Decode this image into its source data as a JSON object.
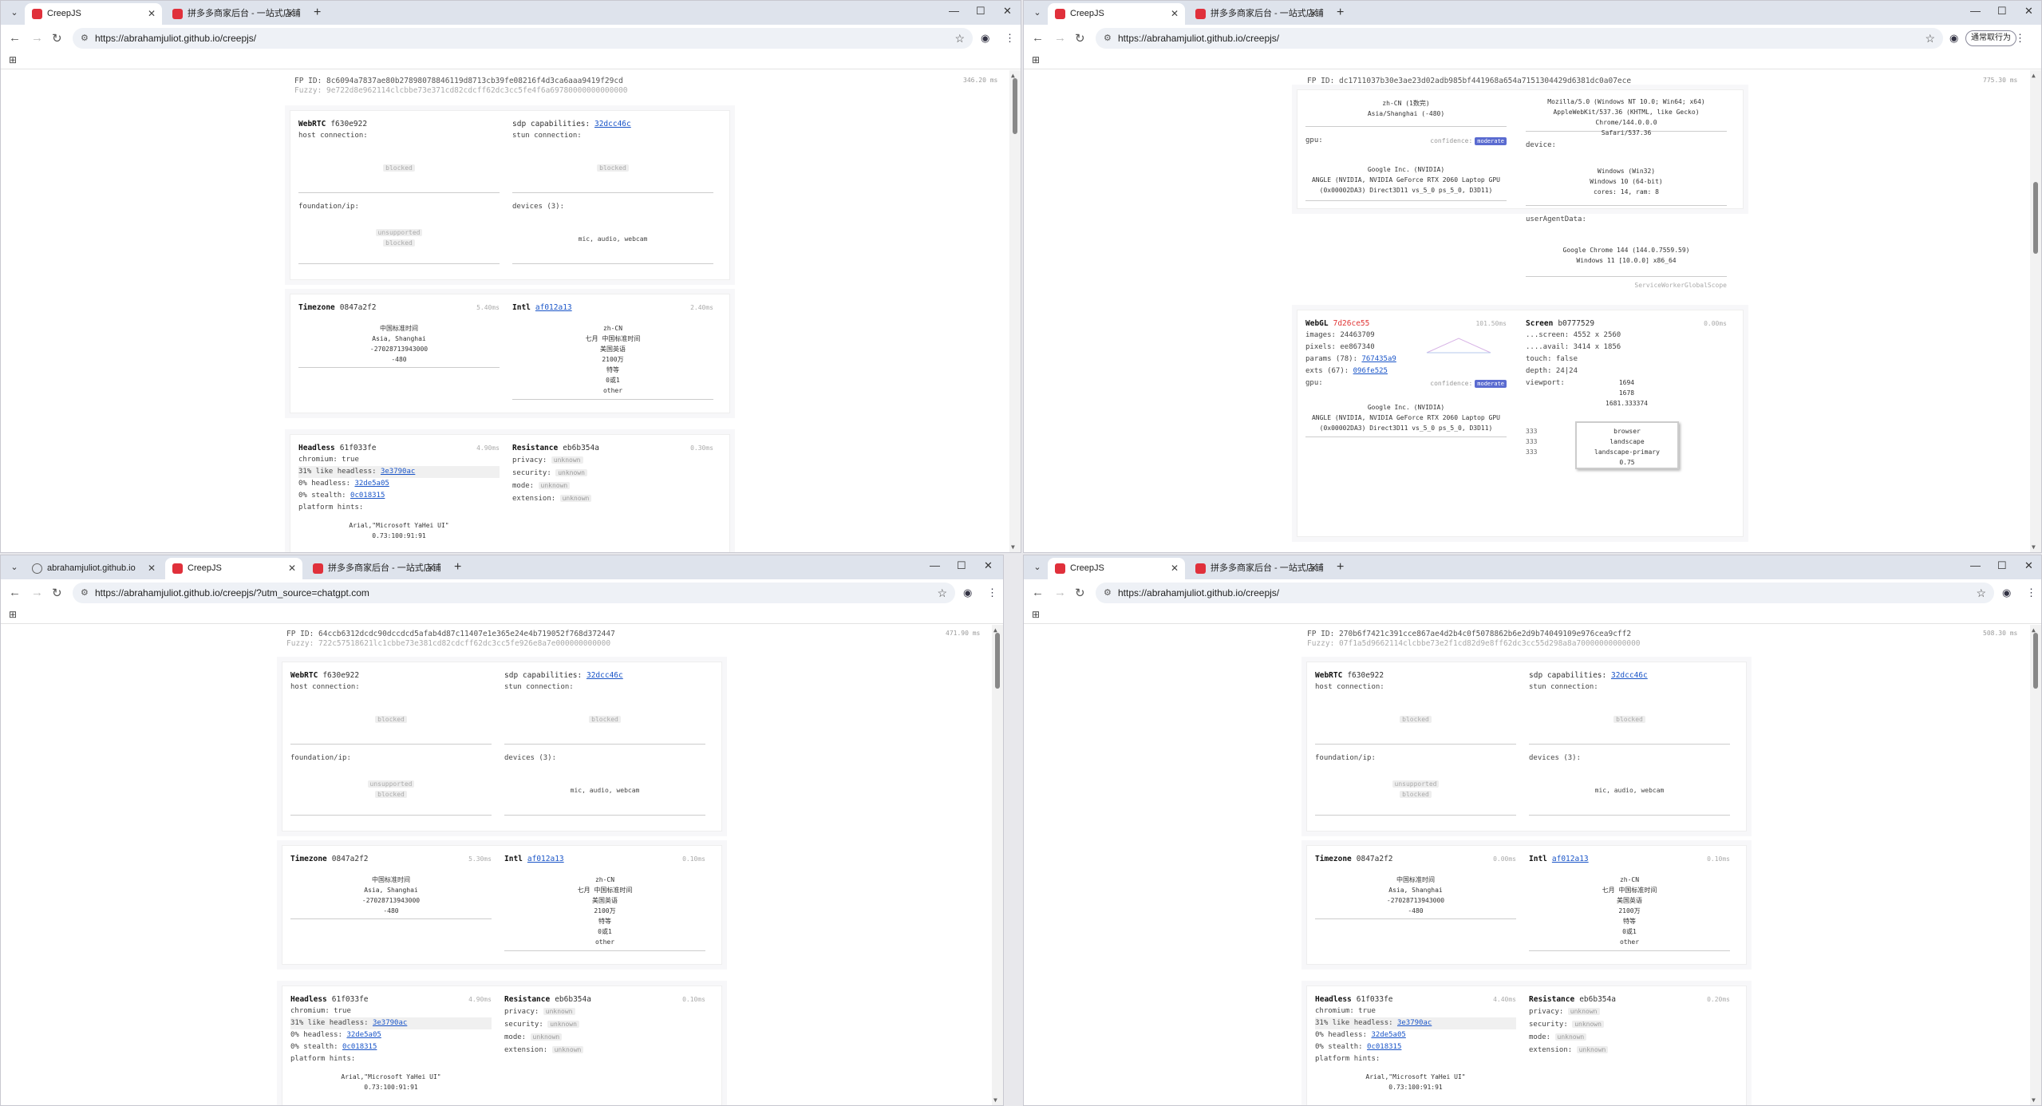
{
  "common": {
    "page_title": "CreepJS",
    "tab2_title": "拼多多商家后台 - 一站式店铺管",
    "url": "https://abrahamjuliot.github.io/creepjs/",
    "win_min": "—",
    "win_max": "☐",
    "win_close": "✕",
    "back": "←",
    "fwd": "→",
    "reload": "↻",
    "newtab": "+",
    "tab_close": "✕",
    "tabdrop": "⌄",
    "apps_glyph": "⊞",
    "star": "☆",
    "menu": "⋮",
    "profile": "◉",
    "tune": "⚙"
  },
  "win1": {
    "fp_id": "FP ID: 8c6094a7837ae80b27898078846119d8713cb39fe08216f4d3ca6aaa9419f29cd",
    "fuzzy": "Fuzzy: 9e722d8e962114clcbbe73e371cd82cdcff62dc3cc5fe4f6a69780000000000000",
    "perf": "346.20 ms",
    "webrtc": {
      "label": "WebRTC",
      "hash": "f630e922",
      "host": "host connection:",
      "host_val": "blocked",
      "sdp": "sdp capabilities:",
      "sdp_hash": "32dcc46c",
      "stun": "stun connection:",
      "stun_val": "blocked",
      "found": "foundation/ip:",
      "found_v1": "unsupported",
      "found_v2": "blocked",
      "devices": "devices (3):",
      "devices_val": "mic, audio, webcam"
    },
    "timezone": {
      "label": "Timezone",
      "hash": "0847a2f2",
      "ms": "5.40ms",
      "l1": "中国标准时间",
      "l2": "Asia, Shanghai",
      "l3": "-27028713943000",
      "l4": "-480"
    },
    "intl": {
      "label": "Intl",
      "hash": "af012a13",
      "ms": "2.40ms",
      "l1": "zh-CN",
      "l2": "七月 中国标准时间",
      "l3": "美国英语",
      "l4": "2100万",
      "l5": "特等",
      "l6": "0或1",
      "l7": "other"
    },
    "headless": {
      "label": "Headless",
      "hash": "61f033fe",
      "ms": "4.90ms",
      "chromium": "chromium: true",
      "like": "31% like headless:",
      "like_hash": "3e3790ac",
      "h0": "0% headless:",
      "h0_hash": "32de5a05",
      "s0": "0% stealth:",
      "s0_hash": "0c018315",
      "hints": "platform hints:",
      "font": "Arial,\"Microsoft YaHei UI\"",
      "fontv": "0.73:100:91:91"
    },
    "resistance": {
      "label": "Resistance",
      "hash": "eb6b354a",
      "ms": "0.30ms",
      "privacy": "privacy:",
      "security": "security:",
      "mode": "mode:",
      "extension": "extension:",
      "unknown": "unknown"
    }
  },
  "win2": {
    "fp_id": "FP ID: dc1711037b30e3ae23d02adb985bf441968a654a7151304429d6381dc0a07ece",
    "fuzzy": "Fuzzy: 0f214a4d6621lc1cbbe73e36lcd82l03ff62dc3cc5fe666e68710000000000000",
    "perf": "775.30 ms",
    "langline1": "zh-CN (1数完)",
    "langline2": "Asia/Shanghai (-480)",
    "ua1": "Mozilla/5.0 (Windows NT 10.0; Win64; x64)",
    "ua2": "AppleWebKit/537.36 (KHTML, like Gecko) Chrome/144.0.0.0",
    "ua3": "Safari/537.36",
    "gpu": "gpu:",
    "confidence": "confidence:",
    "moderate": "moderate",
    "gpu1": "Google Inc. (NVIDIA)",
    "gpu2": "ANGLE (NVIDIA, NVIDIA GeForce RTX 2060 Laptop GPU",
    "gpu3": "(0x00002DA3) Direct3D11 vs_5_0 ps_5_0, D3D11)",
    "device": "device:",
    "dev1": "Windows (Win32)",
    "dev2": "Windows 10 (64-bit)",
    "dev3": "cores: 14, ram: 8",
    "uad": "userAgentData:",
    "uad1": "Google Chrome 144 (144.0.7559.59)",
    "uad2": "Windows 11 [10.0.0] x86_64",
    "sw": "ServiceWorkerGlobalScope",
    "webgl": {
      "label": "WebGL",
      "hash": "7d26ce55",
      "ms": "101.50ms",
      "images": "images:",
      "images_hash": "24463709",
      "pixels": "pixels:",
      "pixels_hash": "ee867340",
      "params": "params (78):",
      "params_hash": "767435a9",
      "exts": "exts (67):",
      "exts_hash": "096fe525"
    },
    "screen": {
      "label": "Screen",
      "hash": "b0777529",
      "ms": "0.00ms",
      "screen": "...screen: 4552 x 2560",
      "avail": "....avail: 3414 x 1856",
      "touch": "touch: false",
      "depth": "depth: 24|24",
      "viewport": "viewport:",
      "vp1": "1694",
      "vp2": "1678",
      "vp3": "1681.333374",
      "side1": "333",
      "side2": "333",
      "side3": "333",
      "o1": "browser",
      "o2": "landscape",
      "o3": "landscape-primary",
      "o4": "0.75"
    }
  },
  "win3": {
    "tab0": "abrahamjuliot.github.io",
    "url": "https://abrahamjuliot.github.io/creepjs/?utm_source=chatgpt.com",
    "fp_id": "FP ID: 64ccb6312dcdc90dccdcd5afab4d87c11407e1e365e24e4b719052f768d372447",
    "fuzzy": "Fuzzy: 722c57518621lc1cbbe73e381cd82cdcff62dc3cc5fe926e8a7e000000000000",
    "perf": "471.90 ms",
    "tz_ms": "5.30ms",
    "intl_ms": "0.10ms",
    "hl_ms": "4.90ms",
    "res_ms": "0.10ms"
  },
  "win4": {
    "fp_id": "FP ID: 270b6f7421c391cce867ae4d2b4c0f5078862b6e2d9b74049109e976cea9cff2",
    "fuzzy": "Fuzzy: 07f1a5d9662114clcbbe73e2f1cd82d9e8ff62dc3cc55d298a8a70000000000000",
    "perf": "508.30 ms",
    "tz_ms": "0.00ms",
    "intl_ms": "0.10ms",
    "hl_ms": "4.40ms",
    "res_ms": "0.20ms",
    "btn": "通常取行为"
  }
}
